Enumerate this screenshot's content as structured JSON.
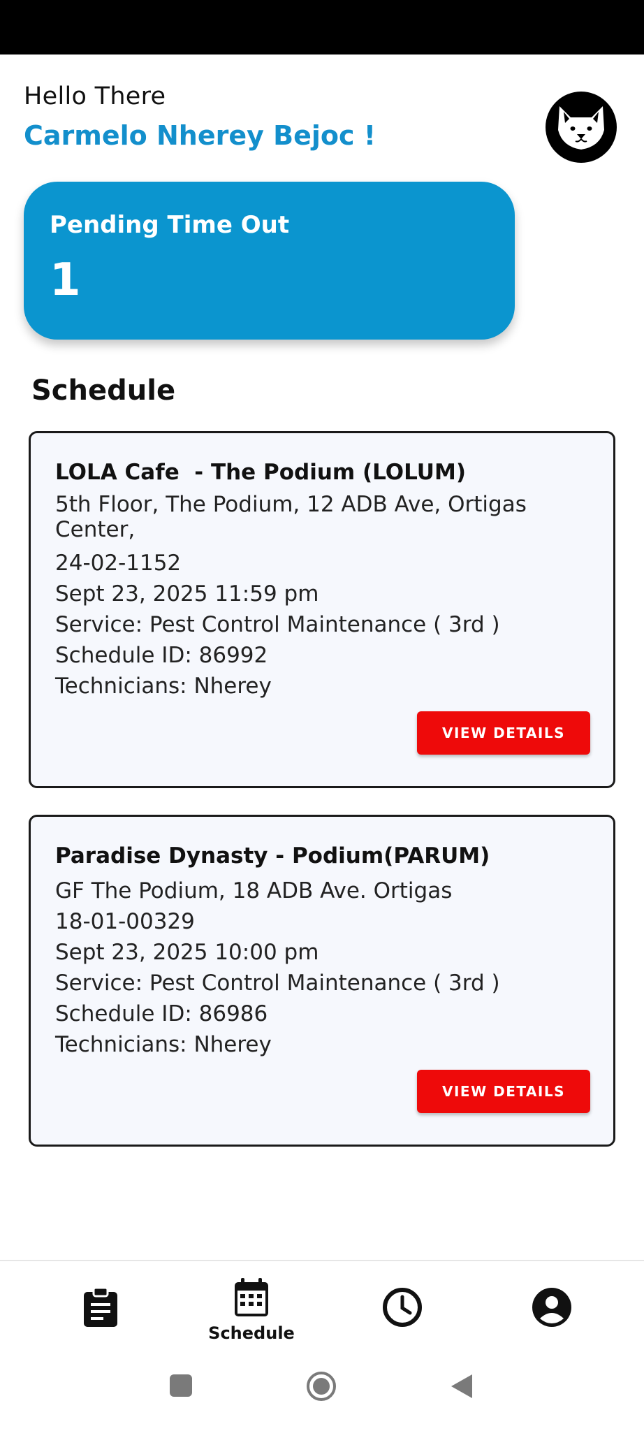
{
  "header": {
    "greeting": "Hello There",
    "user_name": "Carmelo Nherey Bejoc !",
    "avatar_icon": "dog-face-icon"
  },
  "pending": {
    "label": "Pending Time Out",
    "count": "1",
    "color": "#0b95cf"
  },
  "schedule": {
    "title": "Schedule",
    "cards": [
      {
        "title": "LOLA Cafe  - The Podium (LOLUM)",
        "address": "5th Floor, The Podium, 12 ADB Ave, Ortigas Center,",
        "code": "24-02-1152",
        "datetime": "Sept 23, 2025 11:59 pm",
        "service": "Service: Pest Control Maintenance ( 3rd )",
        "schedule_id": "Schedule ID: 86992",
        "technicians": "Technicians: Nherey",
        "button_label": "VIEW DETAILS"
      },
      {
        "title": "Paradise Dynasty - Podium(PARUM)",
        "address": "GF The Podium, 18 ADB Ave. Ortigas",
        "code": "18-01-00329",
        "datetime": "Sept 23, 2025 10:00 pm",
        "service": "Service: Pest Control Maintenance ( 3rd )",
        "schedule_id": "Schedule ID: 86986",
        "technicians": "Technicians: Nherey",
        "button_label": "VIEW DETAILS"
      }
    ]
  },
  "bottom_nav": {
    "items": [
      {
        "icon": "clipboard-icon",
        "label": ""
      },
      {
        "icon": "calendar-icon",
        "label": "Schedule"
      },
      {
        "icon": "clock-icon",
        "label": ""
      },
      {
        "icon": "account-circle-icon",
        "label": ""
      }
    ]
  },
  "colors": {
    "accent": "#138fcc",
    "button": "#ee0a0a"
  }
}
